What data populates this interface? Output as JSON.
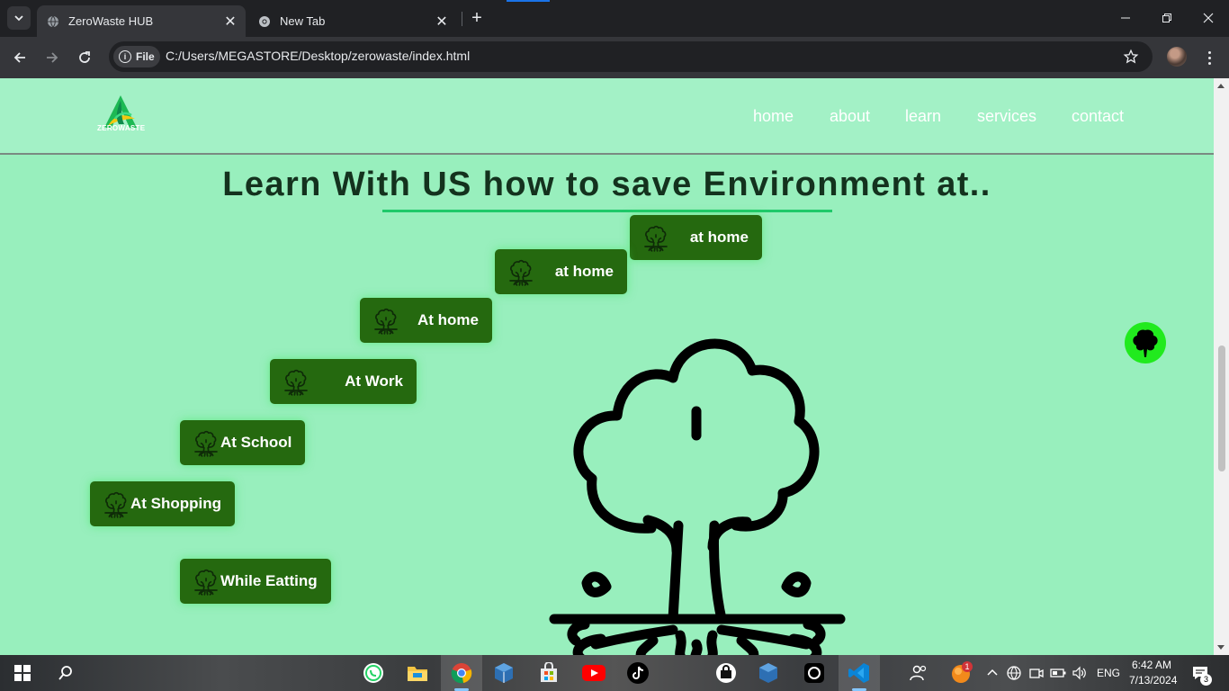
{
  "browser": {
    "tabs": [
      {
        "title": "ZeroWaste HUB",
        "active": true
      },
      {
        "title": "New Tab",
        "active": false
      }
    ],
    "omnibox": {
      "scheme_chip": "File",
      "url": "C:/Users/MEGASTORE/Desktop/zerowaste/index.html"
    }
  },
  "site": {
    "logo_text": "ZEROWASTE",
    "nav": [
      "home",
      "about",
      "learn",
      "services",
      "contact"
    ],
    "heading": "Learn With US how to save Environment at..",
    "buttons": [
      "at home",
      "at home",
      "At home",
      "At Work",
      "At School",
      "At Shopping",
      "While Eatting"
    ]
  },
  "taskbar": {
    "language": "ENG",
    "time": "6:42 AM",
    "date": "7/13/2024",
    "notification_count": "3",
    "app_badge": "1"
  },
  "colors": {
    "page_bg": "#98efbd",
    "header_bg": "#a3f1c6",
    "button_bg": "#25690f",
    "accent_underline": "#1fc96a",
    "float_button": "#21ea1e"
  }
}
